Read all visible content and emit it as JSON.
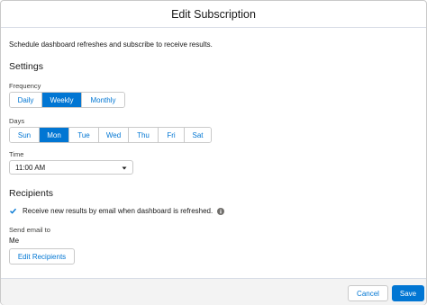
{
  "modal": {
    "title": "Edit Subscription",
    "intro": "Schedule dashboard refreshes and subscribe to receive results."
  },
  "settings": {
    "heading": "Settings",
    "frequency": {
      "label": "Frequency",
      "options": [
        "Daily",
        "Weekly",
        "Monthly"
      ],
      "selected": "Weekly"
    },
    "days": {
      "label": "Days",
      "options": [
        "Sun",
        "Mon",
        "Tue",
        "Wed",
        "Thu",
        "Fri",
        "Sat"
      ],
      "selected": "Mon"
    },
    "time": {
      "label": "Time",
      "value": "11:00 AM"
    }
  },
  "recipients": {
    "heading": "Recipients",
    "checkbox_label": "Receive new results by email when dashboard is refreshed.",
    "checkbox_checked": true,
    "send_email_label": "Send email to",
    "send_email_value": "Me",
    "edit_button": "Edit Recipients"
  },
  "footer": {
    "cancel": "Cancel",
    "save": "Save"
  },
  "colors": {
    "brand": "#0176d3",
    "border": "#c9c9c9",
    "text": "#181818"
  },
  "icons": {
    "time_dropdown": "chevron-down-icon",
    "checkbox": "checkmark-icon",
    "info": "info-icon"
  }
}
